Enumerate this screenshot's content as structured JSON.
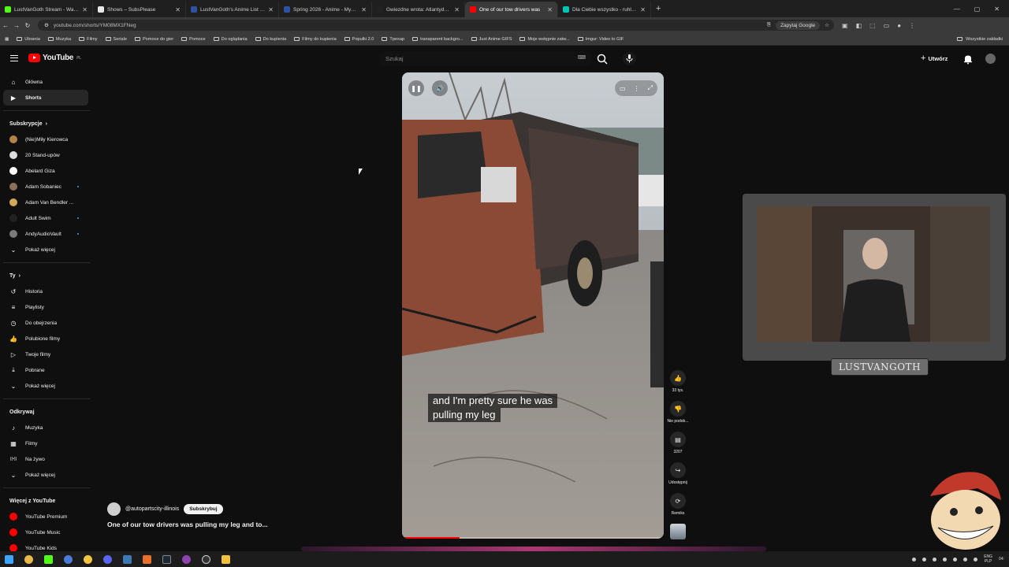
{
  "browser": {
    "tabs": [
      {
        "label": "LustVanGoth Stream - Watch Li",
        "color": "#53fc18",
        "active": false
      },
      {
        "label": "Shows – SubsPlease",
        "color": "#e8e8e8",
        "active": false
      },
      {
        "label": "LustVanGoth's Anime List - My",
        "color": "#2e51a2",
        "active": false
      },
      {
        "label": "Spring 2026 - Anime - MyAnim",
        "color": "#2e51a2",
        "active": false
      },
      {
        "label": "Gwiezdne wrota: Atlantyda / St",
        "color": "#222222",
        "active": false
      },
      {
        "label": "One of our tow drivers was",
        "color": "#ff0000",
        "active": true
      },
      {
        "label": "Dla Ciebie wszystko - ruhla - w",
        "color": "#00c4b4",
        "active": false
      }
    ],
    "url": "youtube.com/shorts/YM08MX1FNeg",
    "google_pill": "Zapytaj Google",
    "bookmarks": [
      "Ubrania",
      "Muzyka",
      "Filmy",
      "Seriale",
      "Pomoce do gier",
      "Pomoce",
      "Do oglądania",
      "Do kupienia",
      "Filmy do kupienia",
      "Popułki 2.0",
      "Tpexap",
      "transparent backgro...",
      "Just Anime GIFS",
      "Moje wstępnie zatw...",
      "Imgur: Video to GIF"
    ],
    "bookmarks_right": "Wszystkie zakładki"
  },
  "header": {
    "logo_text": "YouTube",
    "logo_region": "PL",
    "search_placeholder": "Szukaj",
    "create_label": "Utwórz"
  },
  "sidebar": {
    "main": [
      {
        "label": "Główna",
        "icon": "home-icon"
      },
      {
        "label": "Shorts",
        "icon": "shorts-icon",
        "active": true
      }
    ],
    "subs_heading": "Subskrypcje",
    "subs": [
      {
        "label": "(Nie)Miły Kierowca",
        "color": "#b5824a",
        "dot": false
      },
      {
        "label": "20 Stand-upów",
        "color": "#dddddd",
        "dot": false
      },
      {
        "label": "Abelard Giza",
        "color": "#ffffff",
        "dot": false
      },
      {
        "label": "Adam Sobaniec",
        "color": "#8a6f5a",
        "dot": true
      },
      {
        "label": "Adam Van Bendler ...",
        "color": "#d4a85a",
        "dot": false
      },
      {
        "label": "Adult Swim",
        "color": "#222222",
        "dot": true
      },
      {
        "label": "AndyAudioVault",
        "color": "#7a7a7a",
        "dot": true
      }
    ],
    "subs_more": "Pokaż więcej",
    "you_heading": "Ty",
    "you": [
      {
        "label": "Historia",
        "icon": "history-icon"
      },
      {
        "label": "Playlisty",
        "icon": "playlist-icon"
      },
      {
        "label": "Do obejrzenia",
        "icon": "watch-later-icon"
      },
      {
        "label": "Polubione filmy",
        "icon": "like-icon"
      },
      {
        "label": "Twoje filmy",
        "icon": "your-videos-icon"
      },
      {
        "label": "Pobrane",
        "icon": "download-icon"
      },
      {
        "label": "Pokaż więcej",
        "icon": "chevron-down-icon"
      }
    ],
    "explore_heading": "Odkrywaj",
    "explore": [
      {
        "label": "Muzyka",
        "icon": "music-icon"
      },
      {
        "label": "Filmy",
        "icon": "film-icon"
      },
      {
        "label": "Na żywo",
        "icon": "live-icon"
      },
      {
        "label": "Pokaż więcej",
        "icon": "chevron-down-icon"
      }
    ],
    "more_heading": "Więcej z YouTube",
    "more": [
      {
        "label": "YouTube Premium"
      },
      {
        "label": "YouTube Music"
      },
      {
        "label": "YouTube Kids"
      }
    ]
  },
  "short": {
    "caption_line1": "and I'm pretty sure he was",
    "caption_line2": "pulling my leg",
    "progress": 0.22,
    "channel": "@autopartscity-illinois",
    "subscribe_label": "Subskrybuj",
    "title": "One of our tow drivers was pulling my leg and to...",
    "likes": "33 tys.",
    "dislike_label": "Nie podob...",
    "comments": "3207",
    "share_label": "Udostępnij",
    "remix_label": "Remiks"
  },
  "overlay": {
    "streamer_name": "LUSTVANGOTH"
  },
  "taskbar": {
    "lang_top": "ENG",
    "lang_bottom": "PLP",
    "time": "04:"
  },
  "colors": {
    "accent": "#ff0000",
    "bg": "#0f0f0f",
    "link": "#3ea6ff"
  }
}
